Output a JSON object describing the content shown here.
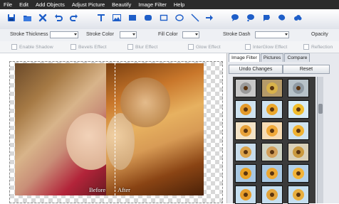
{
  "menu": [
    "File",
    "Edit",
    "Add Objects",
    "Adjust Picture",
    "Beautify",
    "Image Filter",
    "Help"
  ],
  "toolbar_icons": [
    "save-icon",
    "open-icon",
    "delete-icon",
    "redo-icon",
    "text-icon",
    "image-icon",
    "rectangle-icon",
    "rounded-rectangle-icon",
    "ellipse-icon",
    "line-icon",
    "arrow-icon",
    "speech-bubble-icon",
    "thought-bubble-icon",
    "callout-icon",
    "shape-icon",
    "cloud-icon"
  ],
  "props": {
    "stroke_thickness": "Stroke Thickness",
    "stroke_color": "Stroke Color",
    "fill_color": "Fill Color",
    "stroke_dash": "Stroke Dash",
    "opacity": "Opacity"
  },
  "effects": {
    "shadow": "Enable Shadow",
    "bevels": "Bevels Effect",
    "blur": "Blur Effect",
    "glow": "Glow Effect",
    "interglow": "InterGlow Effect",
    "reflection": "Reflection"
  },
  "canvas": {
    "before_label": "Before",
    "after_label": "After"
  },
  "panel": {
    "tabs": [
      "Image Filter",
      "Pictures",
      "Compare"
    ],
    "undo": "Undo Changes",
    "reset": "Reset"
  },
  "colors": {
    "menubar": "#2b2b2b",
    "icon_blue": "#1e5ec8"
  }
}
